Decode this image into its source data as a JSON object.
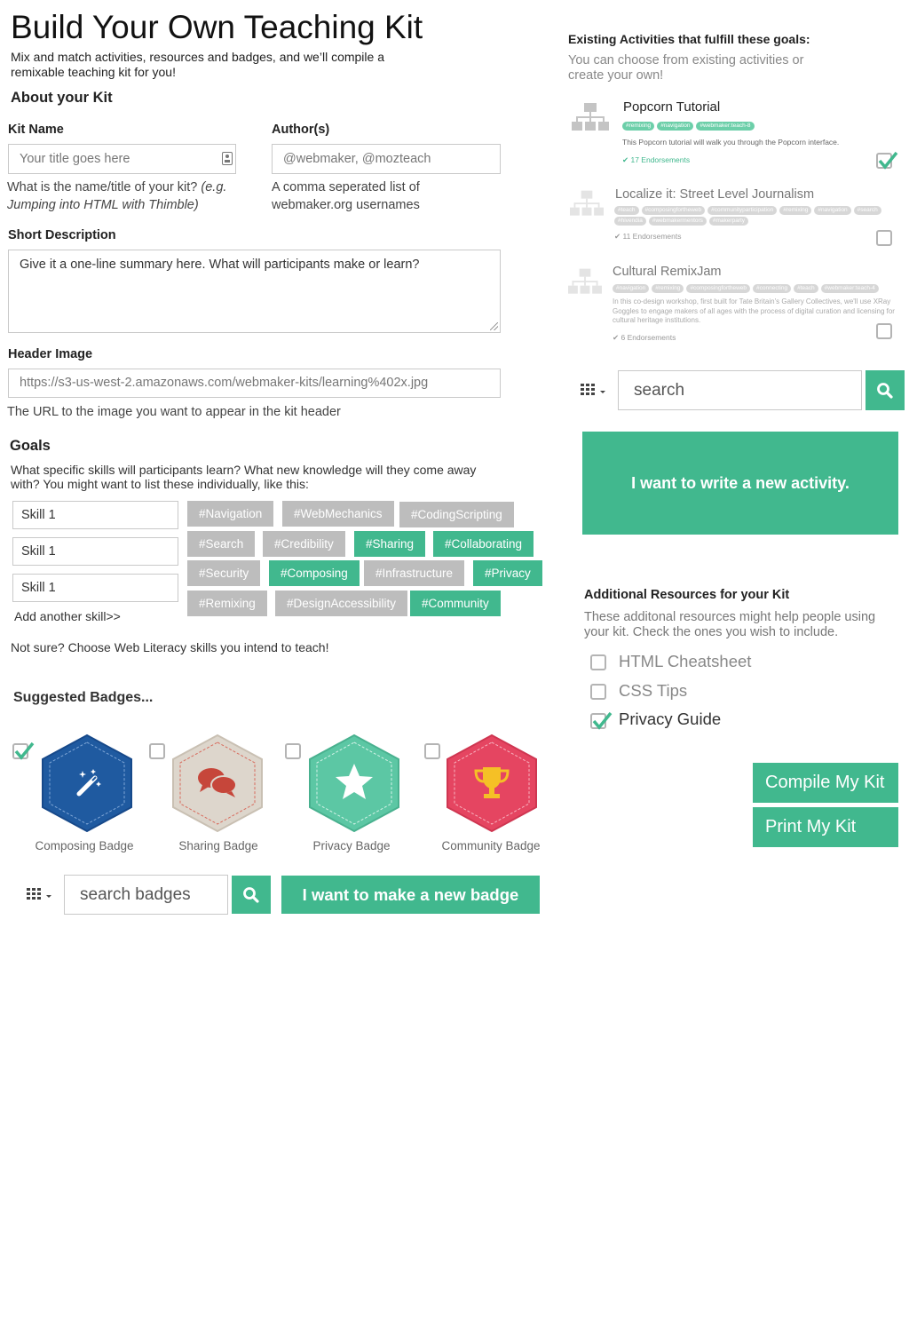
{
  "header": {
    "title": "Build Your Own Teaching Kit",
    "subtitle": "Mix and match activities, resources and badges, and we’ll compile a remixable teaching kit for you!",
    "about": "About your Kit"
  },
  "form": {
    "kit_name_label": "Kit Name",
    "kit_name_placeholder": "Your title goes here",
    "kit_name_help": "What is the name/title of your kit?",
    "kit_name_help_example": "(e.g. Jumping into HTML with Thimble)",
    "author_label": "Author(s)",
    "author_placeholder": "@webmaker, @mozteach",
    "author_help": "A comma seperated list of webmaker.org usernames",
    "short_desc_label": "Short Description",
    "short_desc_placeholder": "Give it a one-line summary here. What will participants make or learn?",
    "header_image_label": "Header Image",
    "header_image_value": "https://s3-us-west-2.amazonaws.com/webmaker-kits/learning%402x.jpg",
    "header_image_help": "The URL to the image you want to appear in the kit header"
  },
  "goals": {
    "heading": "Goals",
    "description": "What specific skills will participants learn? What new knowledge will they come away with? You might want to list these individually, like this:",
    "skills": [
      "Skill 1",
      "Skill 1",
      "Skill 1"
    ],
    "add_skill": "Add another skill>>",
    "not_sure": "Not sure? Choose Web Literacy skills you intend to teach!",
    "tags": [
      {
        "label": "#Navigation",
        "selected": false
      },
      {
        "label": "#WebMechanics",
        "selected": false
      },
      {
        "label": "#CodingScripting",
        "selected": false
      },
      {
        "label": "#Search",
        "selected": false
      },
      {
        "label": "#Credibility",
        "selected": false
      },
      {
        "label": "#Sharing",
        "selected": true
      },
      {
        "label": "#Collaborating",
        "selected": true
      },
      {
        "label": "#Security",
        "selected": false
      },
      {
        "label": "#Composing",
        "selected": true
      },
      {
        "label": "#Infrastructure",
        "selected": false
      },
      {
        "label": "#Privacy",
        "selected": true
      },
      {
        "label": "#Remixing",
        "selected": false
      },
      {
        "label": "#DesignAccessibility",
        "selected": false
      },
      {
        "label": "#Community",
        "selected": true
      }
    ]
  },
  "badges": {
    "heading": "Suggested Badges...",
    "items": [
      {
        "label": "Composing Badge",
        "checked": true,
        "color": "#1f5aa0",
        "icon": "magic-wand-icon"
      },
      {
        "label": "Sharing Badge",
        "checked": false,
        "color": "#ddd6cc",
        "icon": "speech-bubbles-icon"
      },
      {
        "label": "Privacy Badge",
        "checked": false,
        "color": "#5cc7a4",
        "icon": "star-icon"
      },
      {
        "label": "Community Badge",
        "checked": false,
        "color": "#e54561",
        "icon": "trophy-icon"
      }
    ],
    "search_placeholder": "search badges",
    "new_badge_button": "I want to make a new badge"
  },
  "activities": {
    "heading": "Existing Activities that fulfill these goals:",
    "subheading": "You can choose from existing activities or create your own!",
    "items": [
      {
        "title": "Popcorn Tutorial",
        "tags": [
          "#remixing",
          "#navigation",
          "#webmaker:teach-8"
        ],
        "description": "This Popcorn tutorial will walk you through the Popcorn interface.",
        "endorsements": "✔ 17 Endorsements",
        "checked": true
      },
      {
        "title": "Localize it: Street Level Journalism",
        "tags": [
          "#teach",
          "#composingfortheweb",
          "#communityparticipation",
          "#remixing",
          "#navigation",
          "#search",
          "#hivendia",
          "#webmakermentors",
          "#makerparty"
        ],
        "description": "",
        "endorsements": "✔ 11 Endorsements",
        "checked": false
      },
      {
        "title": "Cultural RemixJam",
        "tags": [
          "#navigation",
          "#remixing",
          "#composingfortheweb",
          "#connecting",
          "#teach",
          "#webmaker:teach-4"
        ],
        "description": "In this co-design workshop, first built for Tate Britain's Gallery Collectives, we'll use XRay Goggles to engage makers of all ages with the process of digital curation and licensing for cultural heritage institutions.",
        "endorsements": "✔ 6 Endorsements",
        "checked": false
      }
    ],
    "search_placeholder": "search",
    "new_activity_button": "I want to write a new activity."
  },
  "resources": {
    "heading": "Additional Resources for your Kit",
    "description": "These additonal resources might help people using your kit. Check the ones you wish to include.",
    "items": [
      {
        "label": "HTML Cheatsheet",
        "checked": false
      },
      {
        "label": "CSS Tips",
        "checked": false
      },
      {
        "label": "Privacy Guide",
        "checked": true
      }
    ]
  },
  "actions": {
    "compile": "Compile My Kit",
    "print": "Print My Kit"
  },
  "colors": {
    "accent": "#41b88e",
    "tag_inactive": "#bdbdbd"
  }
}
